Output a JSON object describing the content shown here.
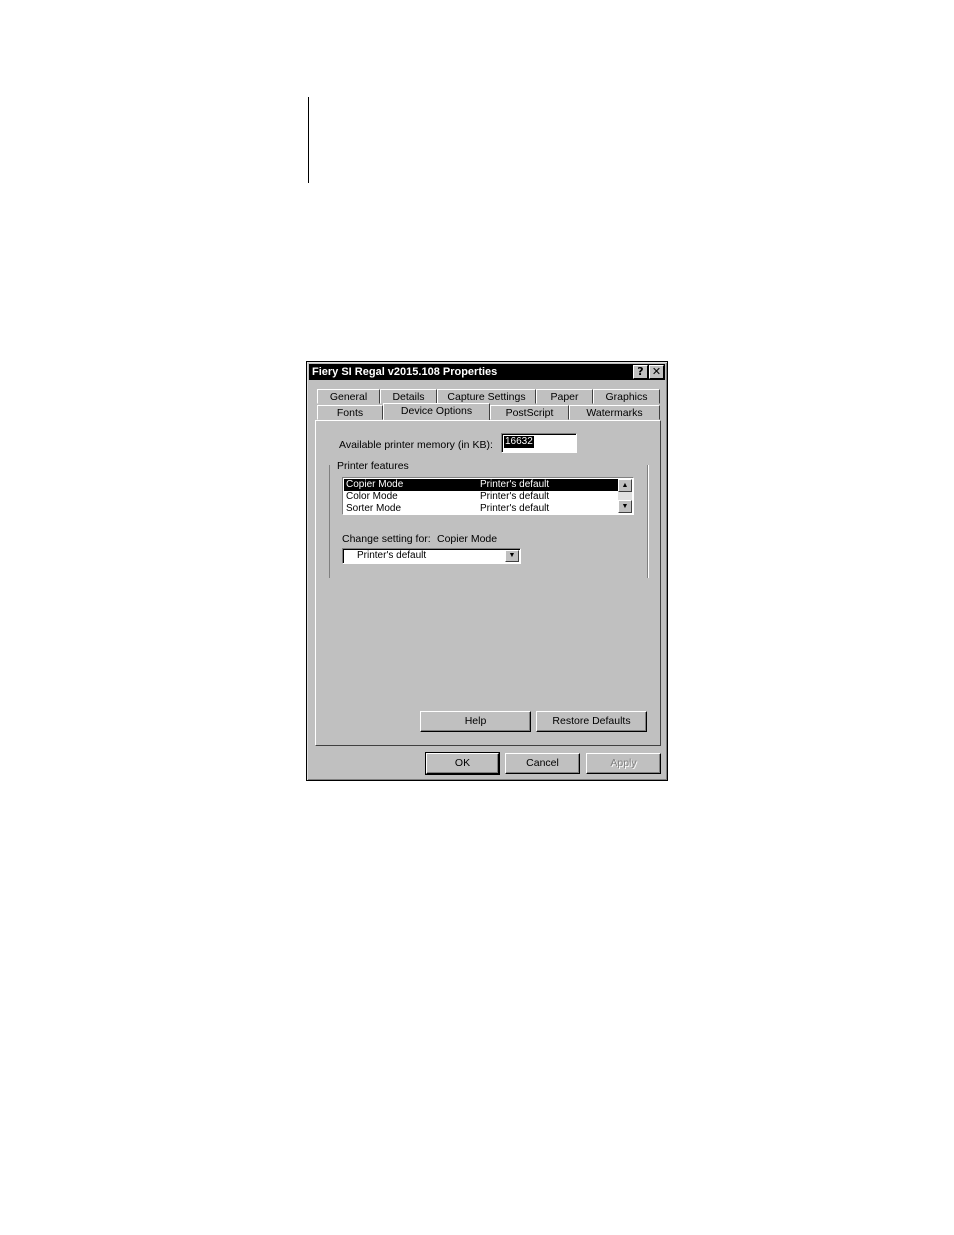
{
  "window": {
    "title": "Fiery SI Regal v2015.108 Properties",
    "help_glyph": "?",
    "close_glyph": "✕"
  },
  "tabs_row1": [
    "General",
    "Details",
    "Capture Settings",
    "Paper",
    "Graphics"
  ],
  "tabs_row2": [
    "Fonts",
    "Device Options",
    "PostScript",
    "Watermarks"
  ],
  "active_tab": "Device Options",
  "memory": {
    "label": "Available printer memory (in KB):",
    "value": "16632"
  },
  "features": {
    "group_label": "Printer features",
    "rows": [
      {
        "feature": "Copier Mode",
        "setting": "Printer's default",
        "selected": true
      },
      {
        "feature": "Color Mode",
        "setting": "Printer's default",
        "selected": false
      },
      {
        "feature": "Sorter Mode",
        "setting": "Printer's default",
        "selected": false
      }
    ]
  },
  "change_setting": {
    "label": "Change setting for:",
    "target": "Copier Mode",
    "value": "Printer's default"
  },
  "buttons": {
    "help": "Help",
    "restore": "Restore Defaults",
    "ok": "OK",
    "cancel": "Cancel",
    "apply": "Apply"
  }
}
